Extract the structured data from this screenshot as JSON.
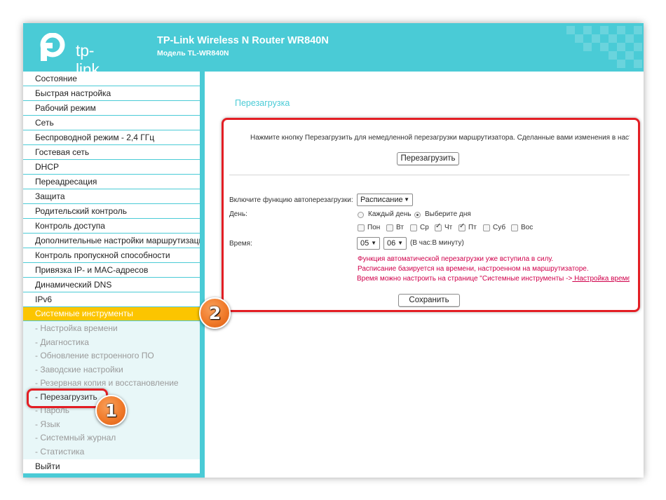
{
  "header": {
    "logo_text": "tp-link",
    "title": "TP-Link Wireless N Router WR840N",
    "model": "Модель TL-WR840N"
  },
  "sidebar": {
    "items": [
      "Состояние",
      "Быстрая настройка",
      "Рабочий режим",
      "Сеть",
      "Беспроводной режим - 2,4 ГГц",
      "Гостевая сеть",
      "DHCP",
      "Переадресация",
      "Защита",
      "Родительский контроль",
      "Контроль доступа",
      "Дополнительные настройки маршрутизации",
      "Контроль пропускной способности",
      "Привязка IP- и MAC-адресов",
      "Динамический DNS",
      "IPv6"
    ],
    "active_item": "Системные инструменты",
    "sub_items": [
      "- Настройка времени",
      "- Диагностика",
      "- Обновление встроенного ПО",
      "- Заводские настройки",
      "- Резервная копия и восстановление",
      "- Перезагрузить",
      "- Пароль",
      "- Язык",
      "- Системный журнал",
      "- Статистика"
    ],
    "logout": "Выйти"
  },
  "content": {
    "page_title": "Перезагрузка",
    "notice": "Нажмите кнопку Перезагрузить для немедленной перезагрузки маршрутизатора. Сделанные вами изменения в настройках будут",
    "reboot_button": "Перезагрузить",
    "auto_reboot_label": "Включите функцию автоперезагрузки:",
    "auto_reboot_value": "Расписание",
    "day_label": "День:",
    "every_day": "Каждый день",
    "select_days": "Выберите дня",
    "days": [
      {
        "label": "Пон",
        "checked": false
      },
      {
        "label": "Вт",
        "checked": false
      },
      {
        "label": "Ср",
        "checked": false
      },
      {
        "label": "Чт",
        "checked": true
      },
      {
        "label": "Пт",
        "checked": true
      },
      {
        "label": "Суб",
        "checked": false
      },
      {
        "label": "Вос",
        "checked": false
      }
    ],
    "time_label": "Время:",
    "hour": "05",
    "minute": "06",
    "time_hint": "(В час:В минуту)",
    "messages": [
      "Функция автоматической перезагрузки уже вступила в силу.",
      "Расписание базируется на времени, настроенном на маршрутизаторе."
    ],
    "message3_prefix": "Время можно настроить на странице \"Системные инструменты ->",
    "message3_link": " Настройка времени\"",
    "save_button": "Сохранить"
  },
  "annotations": {
    "badge1": "1",
    "badge2": "2"
  },
  "colors": {
    "brand": "#4acbd6",
    "active_menu": "#fcc500",
    "highlight": "#e31e24",
    "badge": "#f07a2a",
    "warning_text": "#d0004b"
  }
}
